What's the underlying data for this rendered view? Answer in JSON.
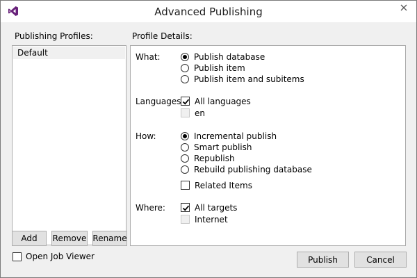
{
  "window": {
    "title": "Advanced Publishing",
    "close_glyph": "✕"
  },
  "profiles": {
    "label": "Publishing Profiles:",
    "items": [
      "Default"
    ],
    "selected": "Default"
  },
  "details": {
    "label": "Profile Details:",
    "what": {
      "label": "What:",
      "options": [
        "Publish database",
        "Publish item",
        "Publish item and subitems"
      ],
      "selected": "Publish database"
    },
    "languages": {
      "label": "Languages:",
      "all_label": "All languages",
      "all_checked": true,
      "items": [
        {
          "label": "en",
          "checked": false,
          "enabled": false
        }
      ]
    },
    "how": {
      "label": "How:",
      "options": [
        "Incremental publish",
        "Smart publish",
        "Republish",
        "Rebuild publishing database"
      ],
      "selected": "Incremental publish",
      "related_items_label": "Related Items",
      "related_items_checked": false
    },
    "where": {
      "label": "Where:",
      "all_label": "All targets",
      "all_checked": true,
      "items": [
        {
          "label": "Internet",
          "checked": false,
          "enabled": false
        }
      ]
    }
  },
  "buttons": {
    "add": "Add",
    "remove": "Remove",
    "rename": "Rename",
    "publish": "Publish",
    "cancel": "Cancel"
  },
  "open_job_viewer": {
    "label": "Open Job Viewer",
    "checked": false
  },
  "icons": {
    "app": "visual-studio-icon",
    "close": "close-icon"
  },
  "colors": {
    "brand": "#68217a",
    "window_bg": "#f0f0f0",
    "border": "#ababab"
  }
}
